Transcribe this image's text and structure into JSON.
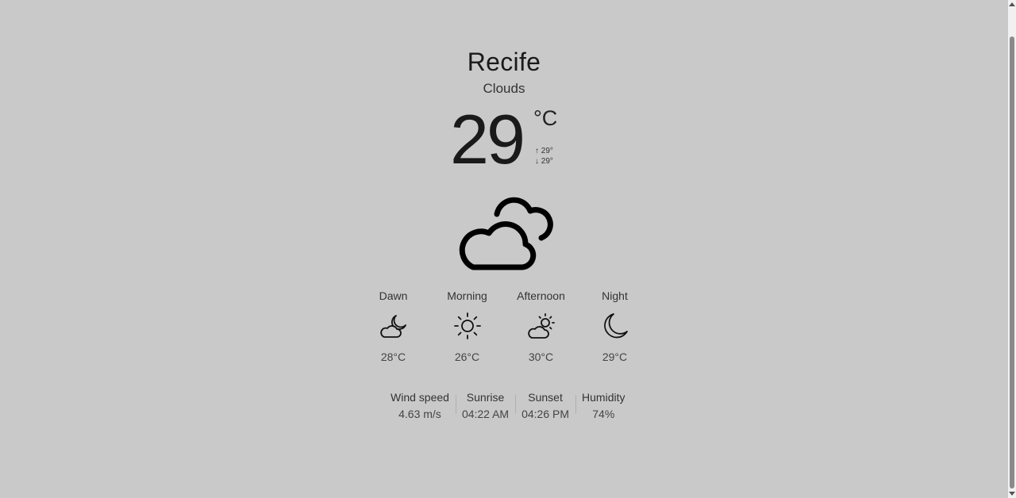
{
  "weather": {
    "city": "Recife",
    "condition": "Clouds",
    "temperature": "29",
    "unit": "°C",
    "max": "↑ 29°",
    "min": "↓ 29°",
    "main_icon": "cloudy-icon"
  },
  "periods": [
    {
      "name": "Dawn",
      "icon": "partly-cloudy-night-icon",
      "temp": "28°C"
    },
    {
      "name": "Morning",
      "icon": "sun-icon",
      "temp": "26°C"
    },
    {
      "name": "Afternoon",
      "icon": "partly-cloudy-day-icon",
      "temp": "30°C"
    },
    {
      "name": "Night",
      "icon": "moon-icon",
      "temp": "29°C"
    }
  ],
  "details": [
    {
      "label": "Wind speed",
      "value": "4.63 m/s"
    },
    {
      "label": "Sunrise",
      "value": "04:22 AM"
    },
    {
      "label": "Sunset",
      "value": "04:26 PM"
    },
    {
      "label": "Humidity",
      "value": "74%"
    }
  ],
  "colors": {
    "background": "#c9c9c9",
    "text": "#1a1a1a"
  }
}
